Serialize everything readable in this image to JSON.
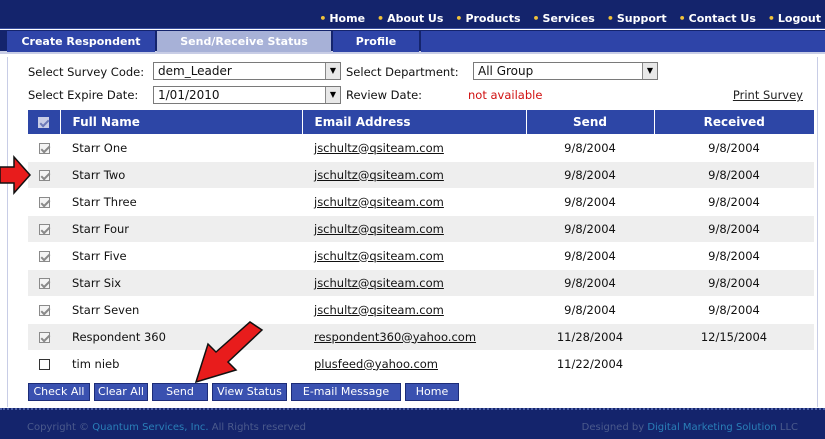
{
  "topnav": {
    "links": [
      "Home",
      "About Us",
      "Products",
      "Services",
      "Support",
      "Contact Us",
      "Logout"
    ]
  },
  "tabs": [
    "Create Respondent",
    "Send/Receive Status",
    "Profile"
  ],
  "filters": {
    "survey_code_label": "Select Survey Code:",
    "survey_code_value": "dem_Leader",
    "department_label": "Select Department:",
    "department_value": "All Group",
    "expire_label": "Select Expire Date:",
    "expire_value": "1/01/2010",
    "review_label": "Review Date:",
    "review_value": "not available",
    "print_label": "Print Survey"
  },
  "table": {
    "headers": [
      "Full Name",
      "Email Address",
      "Send",
      "Received"
    ],
    "rows": [
      {
        "checked": true,
        "name": "Starr One",
        "email": "jschultz@qsiteam.com",
        "send": "9/8/2004",
        "received": "9/8/2004"
      },
      {
        "checked": true,
        "name": "Starr Two",
        "email": "jschultz@qsiteam.com",
        "send": "9/8/2004",
        "received": "9/8/2004"
      },
      {
        "checked": true,
        "name": "Starr Three",
        "email": "jschultz@qsiteam.com",
        "send": "9/8/2004",
        "received": "9/8/2004"
      },
      {
        "checked": true,
        "name": "Starr Four",
        "email": "jschultz@qsiteam.com",
        "send": "9/8/2004",
        "received": "9/8/2004"
      },
      {
        "checked": true,
        "name": "Starr Five",
        "email": "jschultz@qsiteam.com",
        "send": "9/8/2004",
        "received": "9/8/2004"
      },
      {
        "checked": true,
        "name": "Starr Six",
        "email": "jschultz@qsiteam.com",
        "send": "9/8/2004",
        "received": "9/8/2004"
      },
      {
        "checked": true,
        "name": "Starr Seven",
        "email": "jschultz@qsiteam.com",
        "send": "9/8/2004",
        "received": "9/8/2004"
      },
      {
        "checked": true,
        "name": "Respondent 360",
        "email": "respondent360@yahoo.com",
        "send": "11/28/2004",
        "received": "12/15/2004"
      },
      {
        "checked": false,
        "name": "tim nieb",
        "email": "plusfeed@yahoo.com",
        "send": "11/22/2004",
        "received": ""
      }
    ]
  },
  "buttons": [
    "Check All",
    "Clear All",
    "Send",
    "View Status",
    "E-mail Message",
    "Home"
  ],
  "footer": {
    "copyright_prefix": "Copyright ©",
    "company": "Quantum Services, Inc.",
    "rights": "All Rights reserved",
    "designed_prefix": "Designed by",
    "designer": "Digital Marketing Solution",
    "designer_suffix": "LLC"
  },
  "colors": {
    "nav_bg": "#14246c",
    "header_bg": "#2d46a6",
    "active_tab": "#a7b1d7",
    "bullet": "#f0c23a",
    "annotation_arrow": "#e81c1c"
  }
}
